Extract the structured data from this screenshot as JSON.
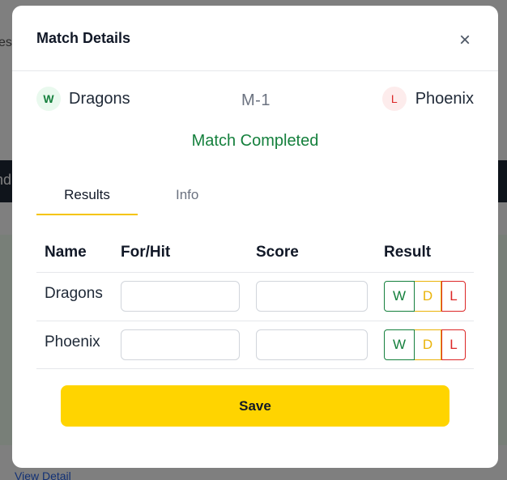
{
  "background": {
    "fragment_top": "es",
    "dark_bar_fragment": "nd",
    "link_fragment": "View Detail"
  },
  "modal": {
    "title": "Match Details",
    "close_label": "×"
  },
  "match": {
    "home_team": {
      "name": "Dragons",
      "result_badge": "W"
    },
    "away_team": {
      "name": "Phoenix",
      "result_badge": "L"
    },
    "code": "M-1",
    "status": "Match Completed"
  },
  "tabs": [
    {
      "label": "Results",
      "active": true
    },
    {
      "label": "Info",
      "active": false
    }
  ],
  "table": {
    "headers": [
      "Name",
      "For/Hit",
      "Score",
      "Result"
    ],
    "rows": [
      {
        "name": "Dragons",
        "for_hit": "",
        "score": ""
      },
      {
        "name": "Phoenix",
        "for_hit": "",
        "score": ""
      }
    ],
    "result_options": [
      "W",
      "D",
      "L"
    ]
  },
  "save_label": "Save",
  "colors": {
    "accent": "#ffd400",
    "win": "#15803d",
    "draw": "#eab308",
    "loss": "#dc2626"
  }
}
